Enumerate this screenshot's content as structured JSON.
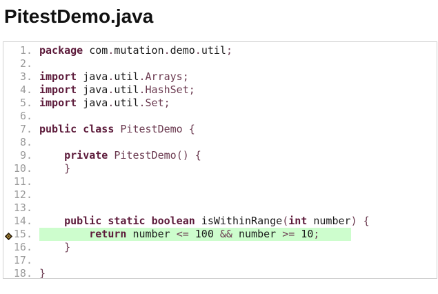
{
  "file": {
    "title": "PitestDemo.java"
  },
  "code": {
    "lines": [
      {
        "number": "1.",
        "tokens": [
          [
            "kw",
            "package"
          ],
          [
            "id",
            " com"
          ],
          [
            "pn",
            "."
          ],
          [
            "id",
            "mutation"
          ],
          [
            "pn",
            "."
          ],
          [
            "id",
            "demo"
          ],
          [
            "pn",
            "."
          ],
          [
            "id",
            "util"
          ],
          [
            "pn",
            ";"
          ]
        ]
      },
      {
        "number": "2.",
        "tokens": []
      },
      {
        "number": "3.",
        "tokens": [
          [
            "kw",
            "import"
          ],
          [
            "id",
            " java"
          ],
          [
            "pn",
            "."
          ],
          [
            "id",
            "util"
          ],
          [
            "pn",
            "."
          ],
          [
            "tp",
            "Arrays"
          ],
          [
            "pn",
            ";"
          ]
        ]
      },
      {
        "number": "4.",
        "tokens": [
          [
            "kw",
            "import"
          ],
          [
            "id",
            " java"
          ],
          [
            "pn",
            "."
          ],
          [
            "id",
            "util"
          ],
          [
            "pn",
            "."
          ],
          [
            "tp",
            "HashSet"
          ],
          [
            "pn",
            ";"
          ]
        ]
      },
      {
        "number": "5.",
        "tokens": [
          [
            "kw",
            "import"
          ],
          [
            "id",
            " java"
          ],
          [
            "pn",
            "."
          ],
          [
            "id",
            "util"
          ],
          [
            "pn",
            "."
          ],
          [
            "tp",
            "Set"
          ],
          [
            "pn",
            ";"
          ]
        ]
      },
      {
        "number": "6.",
        "tokens": []
      },
      {
        "number": "7.",
        "tokens": [
          [
            "kw",
            "public"
          ],
          [
            "id",
            " "
          ],
          [
            "kw",
            "class"
          ],
          [
            "id",
            " "
          ],
          [
            "tp",
            "PitestDemo"
          ],
          [
            "id",
            " "
          ],
          [
            "pn",
            "{"
          ]
        ]
      },
      {
        "number": "8.",
        "tokens": []
      },
      {
        "number": "9.",
        "tokens": [
          [
            "id",
            "    "
          ],
          [
            "kw",
            "private"
          ],
          [
            "id",
            " "
          ],
          [
            "tp",
            "PitestDemo"
          ],
          [
            "pn",
            "()"
          ],
          [
            "id",
            " "
          ],
          [
            "pn",
            "{"
          ]
        ]
      },
      {
        "number": "10.",
        "tokens": [
          [
            "id",
            "    "
          ],
          [
            "pn",
            "}"
          ]
        ]
      },
      {
        "number": "11.",
        "tokens": []
      },
      {
        "number": "12.",
        "tokens": []
      },
      {
        "number": "13.",
        "tokens": []
      },
      {
        "number": "14.",
        "tokens": [
          [
            "id",
            "    "
          ],
          [
            "kw",
            "public"
          ],
          [
            "id",
            " "
          ],
          [
            "kw",
            "static"
          ],
          [
            "id",
            " "
          ],
          [
            "kw",
            "boolean"
          ],
          [
            "id",
            " isWithinRange"
          ],
          [
            "pn",
            "("
          ],
          [
            "kw",
            "int"
          ],
          [
            "id",
            " number"
          ],
          [
            "pn",
            ")"
          ],
          [
            "id",
            " "
          ],
          [
            "pn",
            "{"
          ]
        ]
      },
      {
        "number": "15.",
        "covered": true,
        "mutant_icon": "mutation-killed-icon",
        "tokens": [
          [
            "id",
            "        "
          ],
          [
            "kw",
            "return"
          ],
          [
            "id",
            " number "
          ],
          [
            "pn",
            "<="
          ],
          [
            "id",
            " 100 "
          ],
          [
            "pn",
            "&&"
          ],
          [
            "id",
            " number "
          ],
          [
            "pn",
            ">="
          ],
          [
            "id",
            " 10"
          ],
          [
            "pn",
            ";"
          ]
        ]
      },
      {
        "number": "16.",
        "tokens": [
          [
            "id",
            "    "
          ],
          [
            "pn",
            "}"
          ]
        ]
      },
      {
        "number": "17.",
        "tokens": []
      },
      {
        "number": "18.",
        "tokens": [
          [
            "pn",
            "}"
          ]
        ]
      }
    ]
  },
  "colors": {
    "covered_background": "#cdfdcd",
    "keyword": "#5c1a3a",
    "line_number": "#9a9a9a"
  }
}
